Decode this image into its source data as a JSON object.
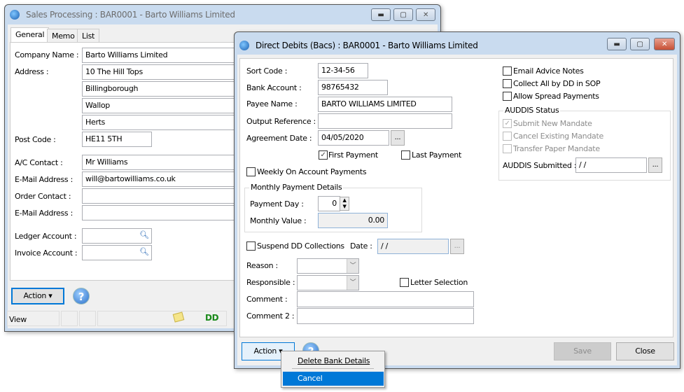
{
  "sales_window": {
    "title": "Sales Processing : BAR0001 - Barto Williams Limited",
    "tabs": [
      {
        "label": "General",
        "active": true
      },
      {
        "label": "Memo"
      },
      {
        "label": "List"
      }
    ],
    "fields": {
      "company_name": {
        "label": "Company Name :",
        "value": "Barto Williams Limited"
      },
      "address": {
        "label": "Address :",
        "lines": [
          "10 The Hill Tops",
          "Billingborough",
          "Wallop",
          "Herts"
        ]
      },
      "post_code": {
        "label": "Post Code :",
        "value": "HE11 5TH"
      },
      "ac_contact": {
        "label": "A/C Contact :",
        "value": "Mr Williams"
      },
      "email": {
        "label": "E-Mail Address :",
        "value": "will@bartowilliams.co.uk"
      },
      "order_contact": {
        "label": "Order Contact :",
        "value": ""
      },
      "email2": {
        "label": "E-Mail Address :",
        "value": ""
      },
      "ledger_account": {
        "label": "Ledger Account :",
        "value": ""
      },
      "invoice_account": {
        "label": "Invoice Account :",
        "value": ""
      }
    },
    "action_label": "Action",
    "status_bar": {
      "mode": "View",
      "icons": [
        "note-icon",
        "direct-debit-icon"
      ]
    }
  },
  "dd_window": {
    "title": "Direct Debits (Bacs) : BAR0001 - Barto Williams Limited",
    "sort_code": {
      "label": "Sort Code :",
      "value": "12-34-56"
    },
    "bank_account": {
      "label": "Bank Account :",
      "value": "98765432"
    },
    "payee_name": {
      "label": "Payee Name :",
      "value": "BARTO WILLIAMS LIMITED"
    },
    "output_reference": {
      "label": "Output Reference :",
      "value": ""
    },
    "agreement_date": {
      "label": "Agreement Date :",
      "value": "04/05/2020"
    },
    "first_payment": {
      "label": "First Payment",
      "checked": true
    },
    "last_payment": {
      "label": "Last Payment",
      "checked": false
    },
    "weekly": {
      "label": "Weekly On Account Payments",
      "checked": false
    },
    "monthly_group": {
      "title": "Monthly Payment Details",
      "payment_day_label": "Payment Day :",
      "payment_day": "0",
      "monthly_value_label": "Monthly Value :",
      "monthly_value": "0.00"
    },
    "suspend": {
      "label": "Suspend DD Collections",
      "checked": false,
      "date_label": "Date :",
      "date_value": " / /"
    },
    "reason": {
      "label": "Reason :",
      "value": ""
    },
    "responsible": {
      "label": "Responsible :",
      "value": ""
    },
    "letter_selection": {
      "label": "Letter Selection",
      "checked": false
    },
    "comment": {
      "label": "Comment :",
      "value": ""
    },
    "comment2": {
      "label": "Comment 2 :",
      "value": ""
    },
    "email_advice": {
      "label": "Email Advice Notes",
      "checked": false
    },
    "collect_all": {
      "label": "Collect All by DD in SOP",
      "checked": false
    },
    "allow_spread": {
      "label": "Allow Spread Payments",
      "checked": false
    },
    "auddis": {
      "title": "AUDDIS Status",
      "submit_new": {
        "label": "Submit New Mandate",
        "checked": true
      },
      "cancel_existing": {
        "label": "Cancel Existing Mandate",
        "checked": false
      },
      "transfer_paper": {
        "label": "Transfer Paper Mandate",
        "checked": false
      },
      "submitted_label": "AUDDIS Submitted :",
      "submitted_value": " / /"
    },
    "ellipsis": "...",
    "action_label": "Action",
    "save_label": "Save",
    "close_label": "Close",
    "menu": [
      {
        "label": "Delete Bank Details"
      },
      {
        "label": "Cancel",
        "highlighted": true
      }
    ]
  },
  "colors": {
    "highlight": "#0078d7",
    "titlebar": "#c9dbef"
  }
}
